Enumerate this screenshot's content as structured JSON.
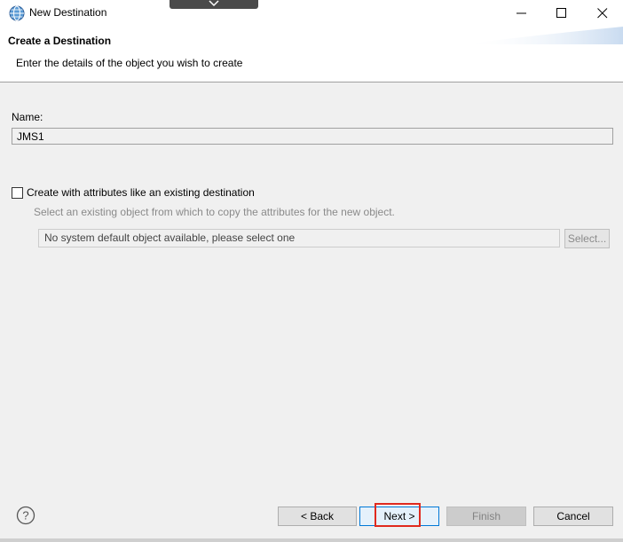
{
  "window": {
    "title": "New Destination"
  },
  "banner": {
    "title": "Create a Destination",
    "description": "Enter the details of the object you wish to create"
  },
  "name_field": {
    "label": "Name:",
    "value": "JMS1"
  },
  "copy_option": {
    "checkbox_label": "Create with attributes like an existing destination",
    "checked": false,
    "hint": "Select an existing object from which to copy the attributes for the new object.",
    "object_value": "No system default object available, please select one",
    "select_label": "Select..."
  },
  "footer": {
    "back_label": "< Back",
    "next_label": "Next >",
    "finish_label": "Finish",
    "cancel_label": "Cancel"
  },
  "colors": {
    "highlight": "#e02a1f",
    "focus_border": "#0078d7",
    "window_bg": "#f0f0f0"
  },
  "icons": {
    "app": "globe-icon",
    "help": "help-icon"
  }
}
